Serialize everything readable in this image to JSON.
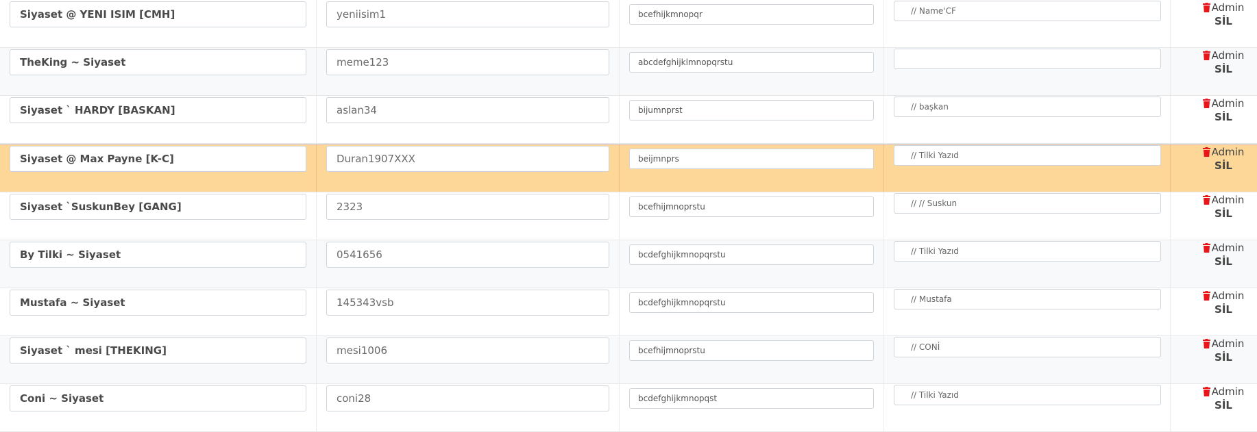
{
  "rows": [
    {
      "name": "Siyaset @ YENI ISIM [CMH]",
      "password": "yeniisim1",
      "permissions": "bcefhijkmnopqr",
      "note": "// Name'CF",
      "delete_label": "Admin",
      "delete_sub": "SİL"
    },
    {
      "name": "TheKing ~ Siyaset",
      "password": "meme123",
      "permissions": "abcdefghijklmnopqrstu",
      "note": "",
      "delete_label": "Admin",
      "delete_sub": "SİL"
    },
    {
      "name": "Siyaset ` HARDY [BASKAN]",
      "password": "aslan34",
      "permissions": "bijumnprst",
      "note": "// başkan",
      "delete_label": "Admin",
      "delete_sub": "SİL"
    },
    {
      "name": "Siyaset @ Max Payne [K-C]",
      "password": "Duran1907XXX",
      "permissions": "beijmnprs",
      "note": "// Tilki Yazıd",
      "delete_label": "Admin",
      "delete_sub": "SİL"
    },
    {
      "name": "Siyaset `SuskunBey [GANG]",
      "password": "2323",
      "permissions": "bcefhijmnoprstu",
      "note": "// // Suskun",
      "delete_label": "Admin",
      "delete_sub": "SİL"
    },
    {
      "name": "By Tilki ~ Siyaset",
      "password": "0541656",
      "permissions": "bcdefghijkmnopqrstu",
      "note": "// Tilki Yazıd",
      "delete_label": "Admin",
      "delete_sub": "SİL"
    },
    {
      "name": "Mustafa ~ Siyaset",
      "password": "145343vsb",
      "permissions": "bcdefghijkmnopqrstu",
      "note": "// Mustafa",
      "delete_label": "Admin",
      "delete_sub": "SİL"
    },
    {
      "name": "Siyaset ` mesi  [THEKING]",
      "password": "mesi1006",
      "permissions": "bcefhijmnoprstu",
      "note": "// CONİ",
      "delete_label": "Admin",
      "delete_sub": "SİL"
    },
    {
      "name": "Coni ~ Siyaset",
      "password": "coni28",
      "permissions": "bcdefghijkmnopqst",
      "note": "// Tilki Yazıd",
      "delete_label": "Admin",
      "delete_sub": "SİL"
    }
  ],
  "colors": {
    "highlight_row": "#fdd798",
    "trash_icon": "#e8161b"
  },
  "icons": {
    "delete": "trash-icon"
  }
}
